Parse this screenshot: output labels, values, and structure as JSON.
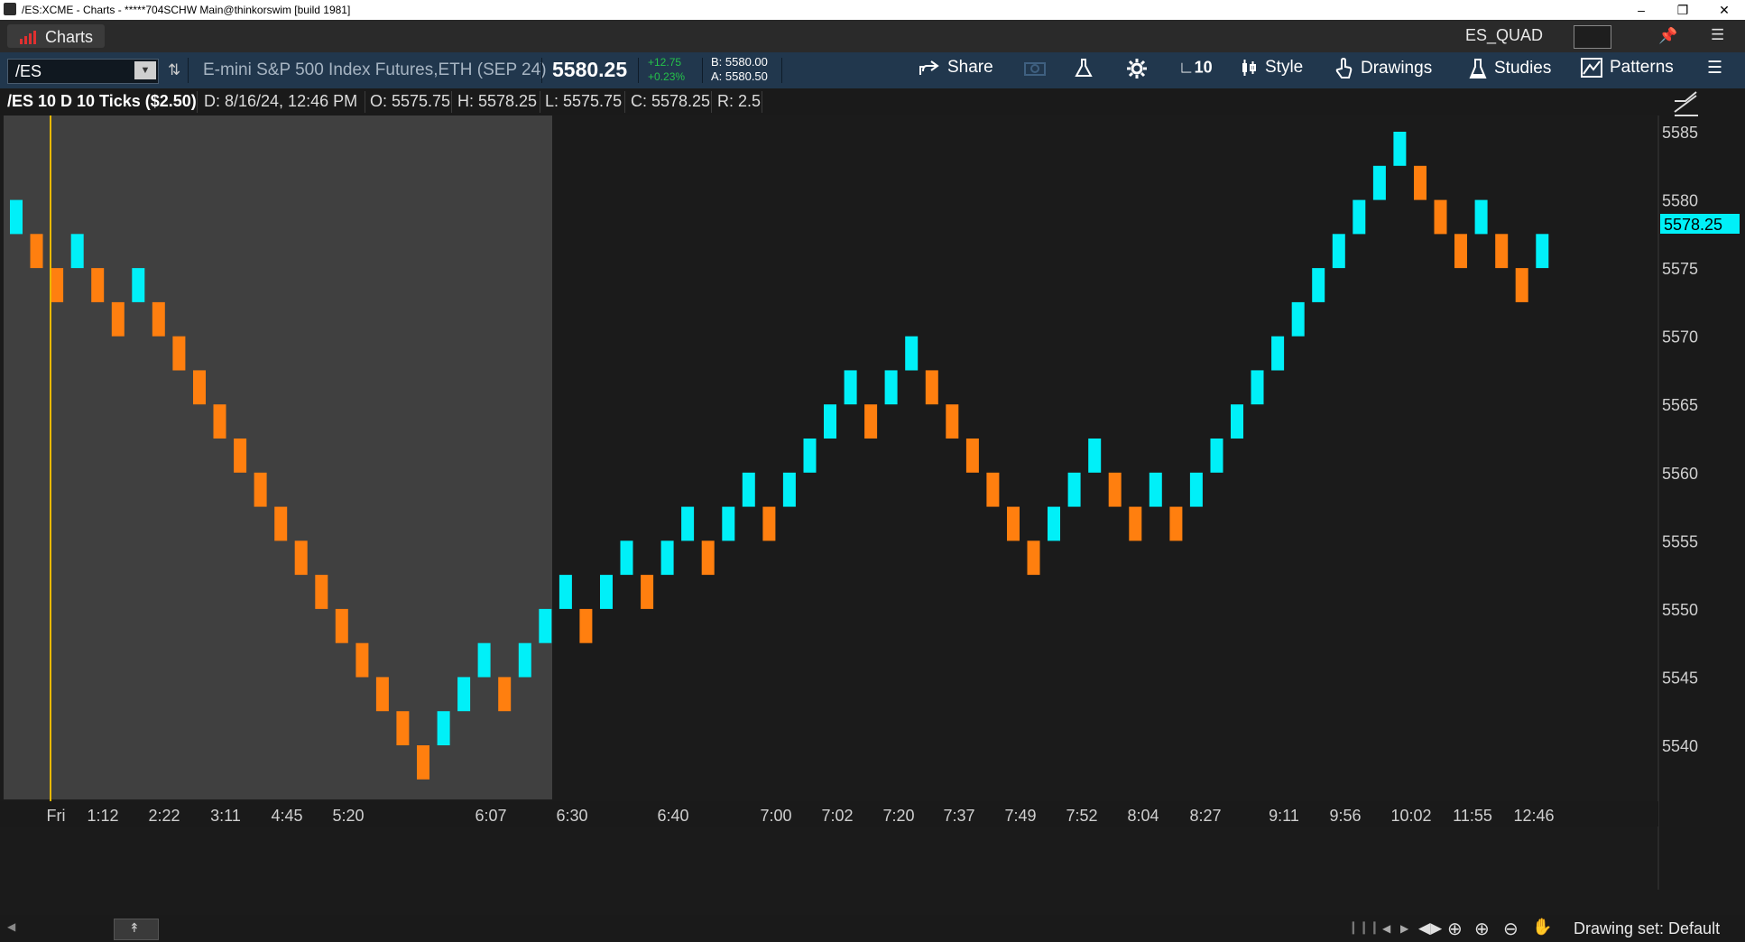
{
  "window": {
    "title": "/ES:XCME - Charts - *****704SCHW Main@thinkorswim [build 1981]"
  },
  "tabs": {
    "charts_label": "Charts",
    "workspace": "ES_QUAD"
  },
  "toolbar": {
    "symbol": "/ES",
    "description": "E-mini S&P 500 Index Futures,ETH (SEP 24)",
    "last_price": "5580.25",
    "change": "+12.75",
    "change_pct": "+0.23%",
    "bid": "B: 5580.00",
    "ask": "A: 5580.50",
    "share_label": "Share",
    "interval_label": "10",
    "style_label": "Style",
    "drawings_label": "Drawings",
    "studies_label": "Studies",
    "patterns_label": "Patterns"
  },
  "infobar": {
    "title": "/ES 10 D 10 Ticks ($2.50)",
    "date": "D: 8/16/24, 12:46 PM",
    "open": "O: 5575.75",
    "high": "H: 5578.25",
    "low": "L: 5575.75",
    "close": "C: 5578.25",
    "range": "R: 2.5"
  },
  "bottom": {
    "drawing_set": "Drawing set: Default"
  },
  "colors": {
    "up": "#00f0f8",
    "down": "#ff7f0f",
    "cursor": "#e8b800",
    "price_badge": "#00f0f8",
    "background": "#1b1b1b",
    "premarket": "#404040"
  },
  "chart_data": {
    "type": "renko",
    "brick_size": 2.5,
    "ylim": [
      5537.5,
      5588.75
    ],
    "y_ticks": [
      5585,
      5580,
      5575,
      5570,
      5565,
      5560,
      5555,
      5550,
      5545,
      5540
    ],
    "current_price": "5578.25",
    "x_tick_labels": [
      "Fri",
      "1:12",
      "2:22",
      "3:11",
      "4:45",
      "5:20",
      "6:07",
      "6:30",
      "6:40",
      "7:00",
      "7:02",
      "7:20",
      "7:37",
      "7:49",
      "7:52",
      "8:04",
      "8:27",
      "9:11",
      "9:56",
      "10:02",
      "11:55",
      "12:46"
    ],
    "bricks": [
      {
        "dir": "up",
        "low": 5577.5
      },
      {
        "dir": "down",
        "low": 5575
      },
      {
        "dir": "down",
        "low": 5572.5
      },
      {
        "dir": "up",
        "low": 5575
      },
      {
        "dir": "down",
        "low": 5572.5
      },
      {
        "dir": "down",
        "low": 5570
      },
      {
        "dir": "up",
        "low": 5572.5
      },
      {
        "dir": "down",
        "low": 5570
      },
      {
        "dir": "down",
        "low": 5567.5
      },
      {
        "dir": "down",
        "low": 5565
      },
      {
        "dir": "down",
        "low": 5562.5
      },
      {
        "dir": "down",
        "low": 5560
      },
      {
        "dir": "down",
        "low": 5557.5
      },
      {
        "dir": "down",
        "low": 5555
      },
      {
        "dir": "down",
        "low": 5552.5
      },
      {
        "dir": "down",
        "low": 5550
      },
      {
        "dir": "down",
        "low": 5547.5
      },
      {
        "dir": "down",
        "low": 5545
      },
      {
        "dir": "down",
        "low": 5542.5
      },
      {
        "dir": "down",
        "low": 5540
      },
      {
        "dir": "down",
        "low": 5537.5
      },
      {
        "dir": "up",
        "low": 5540
      },
      {
        "dir": "up",
        "low": 5542.5
      },
      {
        "dir": "up",
        "low": 5545
      },
      {
        "dir": "down",
        "low": 5542.5
      },
      {
        "dir": "up",
        "low": 5545
      },
      {
        "dir": "up",
        "low": 5547.5
      },
      {
        "dir": "up",
        "low": 5550
      },
      {
        "dir": "down",
        "low": 5547.5
      },
      {
        "dir": "up",
        "low": 5550
      },
      {
        "dir": "up",
        "low": 5552.5
      },
      {
        "dir": "down",
        "low": 5550
      },
      {
        "dir": "up",
        "low": 5552.5
      },
      {
        "dir": "up",
        "low": 5555
      },
      {
        "dir": "down",
        "low": 5552.5
      },
      {
        "dir": "up",
        "low": 5555
      },
      {
        "dir": "up",
        "low": 5557.5
      },
      {
        "dir": "down",
        "low": 5555
      },
      {
        "dir": "up",
        "low": 5557.5
      },
      {
        "dir": "up",
        "low": 5560
      },
      {
        "dir": "up",
        "low": 5562.5
      },
      {
        "dir": "up",
        "low": 5565
      },
      {
        "dir": "down",
        "low": 5562.5
      },
      {
        "dir": "up",
        "low": 5565
      },
      {
        "dir": "up",
        "low": 5567.5
      },
      {
        "dir": "down",
        "low": 5565
      },
      {
        "dir": "down",
        "low": 5562.5
      },
      {
        "dir": "down",
        "low": 5560
      },
      {
        "dir": "down",
        "low": 5557.5
      },
      {
        "dir": "down",
        "low": 5555
      },
      {
        "dir": "down",
        "low": 5552.5
      },
      {
        "dir": "up",
        "low": 5555
      },
      {
        "dir": "up",
        "low": 5557.5
      },
      {
        "dir": "up",
        "low": 5560
      },
      {
        "dir": "down",
        "low": 5557.5
      },
      {
        "dir": "down",
        "low": 5555
      },
      {
        "dir": "up",
        "low": 5557.5
      },
      {
        "dir": "down",
        "low": 5555
      },
      {
        "dir": "up",
        "low": 5557.5
      },
      {
        "dir": "up",
        "low": 5560
      },
      {
        "dir": "up",
        "low": 5562.5
      },
      {
        "dir": "up",
        "low": 5565
      },
      {
        "dir": "up",
        "low": 5567.5
      },
      {
        "dir": "up",
        "low": 5570
      },
      {
        "dir": "up",
        "low": 5572.5
      },
      {
        "dir": "up",
        "low": 5575
      },
      {
        "dir": "up",
        "low": 5577.5
      },
      {
        "dir": "up",
        "low": 5580
      },
      {
        "dir": "up",
        "low": 5582.5
      },
      {
        "dir": "down",
        "low": 5580
      },
      {
        "dir": "down",
        "low": 5577.5
      },
      {
        "dir": "down",
        "low": 5575
      },
      {
        "dir": "up",
        "low": 5577.5
      },
      {
        "dir": "down",
        "low": 5575
      },
      {
        "dir": "down",
        "low": 5572.5
      },
      {
        "dir": "up",
        "low": 5575
      }
    ]
  }
}
